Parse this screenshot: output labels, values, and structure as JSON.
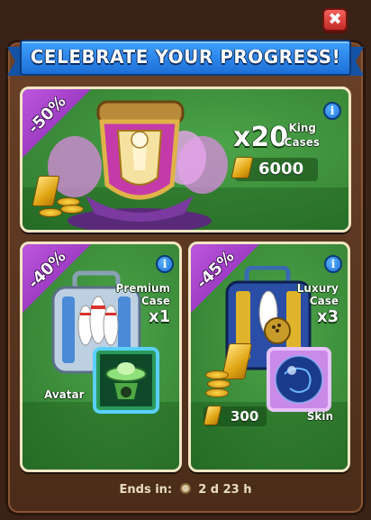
{
  "banner": {
    "title": "CELEBRATE YOUR PROGRESS!"
  },
  "close_icon": "✖",
  "info_icon": "i",
  "offers": {
    "main": {
      "discount": "-50%",
      "quantity": "x20",
      "item_line1": "King",
      "item_line2": "Cases",
      "price": "6000",
      "currency_icon": "gold-bar-icon"
    },
    "left": {
      "discount": "-40%",
      "item_line1": "Premium",
      "item_line2": "Case",
      "quantity": "x1",
      "extra": "Avatar"
    },
    "right": {
      "discount": "-45%",
      "item_line1": "Luxury",
      "item_line2": "Case",
      "quantity": "x3",
      "price": "300",
      "extra": "Skin",
      "currency_icon": "gold-bar-icon"
    }
  },
  "timer": {
    "label": "Ends in:",
    "value": "2 d 23 h",
    "icon": "clock-icon"
  },
  "colors": {
    "card_green": "#3f953f",
    "ribbon_blue": "#2a86ea",
    "discount_purple": "#a040d0",
    "frame_brown": "#5a3520",
    "close_red": "#d83a32"
  }
}
